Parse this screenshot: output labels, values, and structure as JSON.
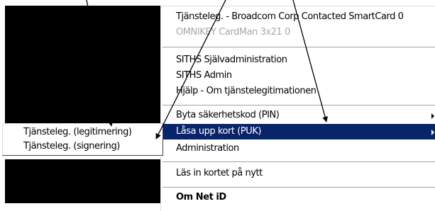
{
  "main_menu": {
    "items": [
      {
        "label": "Tjänsteleg. - Broadcom Corp Contacted SmartCard 0",
        "state": "normal"
      },
      {
        "label": "OMNIKEY CardMan 3x21 0",
        "state": "disabled"
      },
      {
        "label": "SITHS Självadministration",
        "state": "normal"
      },
      {
        "label": "SITHS Admin",
        "state": "normal"
      },
      {
        "label": "Hjälp - Om tjänstelegitimationen",
        "state": "normal"
      },
      {
        "label": "Byta säkerhetskod (PIN)",
        "state": "normal",
        "submenu": true
      },
      {
        "label": "Låsa upp kort (PUK)",
        "state": "highlighted",
        "submenu": true
      },
      {
        "label": "Administration",
        "state": "normal"
      },
      {
        "label": "Läs in kortet på nytt",
        "state": "normal"
      },
      {
        "label": "Om Net iD",
        "state": "bold"
      }
    ]
  },
  "submenu": {
    "items": [
      {
        "label": "Tjänsteleg. (legitimering)"
      },
      {
        "label": "Tjänsteleg. (signering)"
      }
    ]
  },
  "colors": {
    "highlight": "#0a246a",
    "highlight_text": "#ffffff",
    "disabled_text": "#a8a8a8",
    "panel_background": "#000000",
    "annotation_arrow": "#000000"
  },
  "icons": {
    "submenu_arrow": "triangle-right",
    "annotation_arrow": "arrow"
  }
}
